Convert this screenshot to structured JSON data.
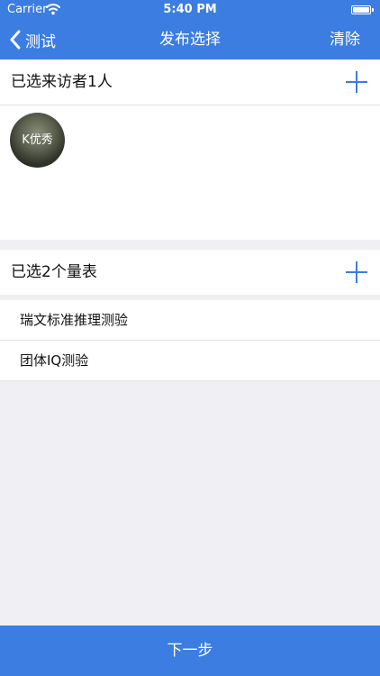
{
  "status_bar": {
    "carrier": "Carrier",
    "time": "5:40 PM"
  },
  "nav": {
    "back_label": "测试",
    "title": "发布选择",
    "clear_label": "清除"
  },
  "visitors": {
    "header_label": "已选来访者1人",
    "items": [
      {
        "name": "K优秀"
      }
    ]
  },
  "scales": {
    "header_label": "已选2个量表",
    "items": [
      {
        "label": "瑞文标准推理测验"
      },
      {
        "label": "团体IQ测验"
      }
    ]
  },
  "footer": {
    "next_label": "下一步"
  },
  "colors": {
    "accent": "#3b7de0",
    "background": "#efeff4"
  }
}
